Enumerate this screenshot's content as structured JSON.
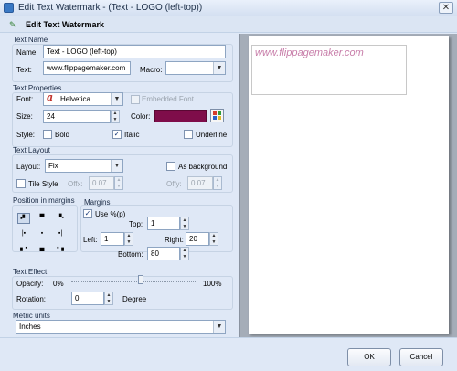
{
  "window": {
    "title": "Edit Text Watermark - (Text - LOGO (left-top))",
    "close_icon": "close-icon"
  },
  "header": {
    "title": "Edit Text Watermark",
    "icon": "watermark-edit-icon"
  },
  "text_name": {
    "section": "Text Name",
    "name_label": "Name:",
    "name_value": "Text - LOGO (left-top)",
    "text_label": "Text:",
    "text_value": "www.flippagemaker.com",
    "macro_label": "Macro:",
    "macro_value": ""
  },
  "text_properties": {
    "section": "Text Properties",
    "font_label": "Font:",
    "font_value": "Helvetica",
    "embedded_label": "Embedded Font",
    "embedded_checked": false,
    "size_label": "Size:",
    "size_value": "24",
    "color_label": "Color:",
    "color_value": "#7f0d4a",
    "style_label": "Style:",
    "bold_label": "Bold",
    "bold_checked": false,
    "italic_label": "Italic",
    "italic_checked": true,
    "underline_label": "Underline",
    "underline_checked": false
  },
  "text_layout": {
    "section": "Text Layout",
    "layout_label": "Layout:",
    "layout_value": "Fix",
    "as_background_label": "As background",
    "as_background_checked": false,
    "tile_style_label": "Tile Style",
    "tile_style_checked": false,
    "offx_label": "Offx:",
    "offx_value": "0.07",
    "offy_label": "Offy:",
    "offy_value": "0.07"
  },
  "position": {
    "section": "Position in margins",
    "selected": "top-left"
  },
  "margins": {
    "section": "Margins",
    "use_percent_label": "Use %(p)",
    "use_percent_checked": true,
    "top_label": "Top:",
    "top_value": "1",
    "left_label": "Left:",
    "left_value": "1",
    "right_label": "Right:",
    "right_value": "20",
    "bottom_label": "Bottom:",
    "bottom_value": "80"
  },
  "text_effect": {
    "section": "Text Effect",
    "opacity_label": "Opacity:",
    "opacity_min": "0%",
    "opacity_max": "100%",
    "opacity_level": 0.55,
    "rotation_label": "Rotation:",
    "rotation_value": "0",
    "degree_label": "Degree"
  },
  "metric": {
    "section": "Metric units",
    "value": "Inches"
  },
  "preview": {
    "watermark_text": "www.flippagemaker.com",
    "watermark_color": "#c77ca8"
  },
  "buttons": {
    "ok": "OK",
    "cancel": "Cancel"
  }
}
